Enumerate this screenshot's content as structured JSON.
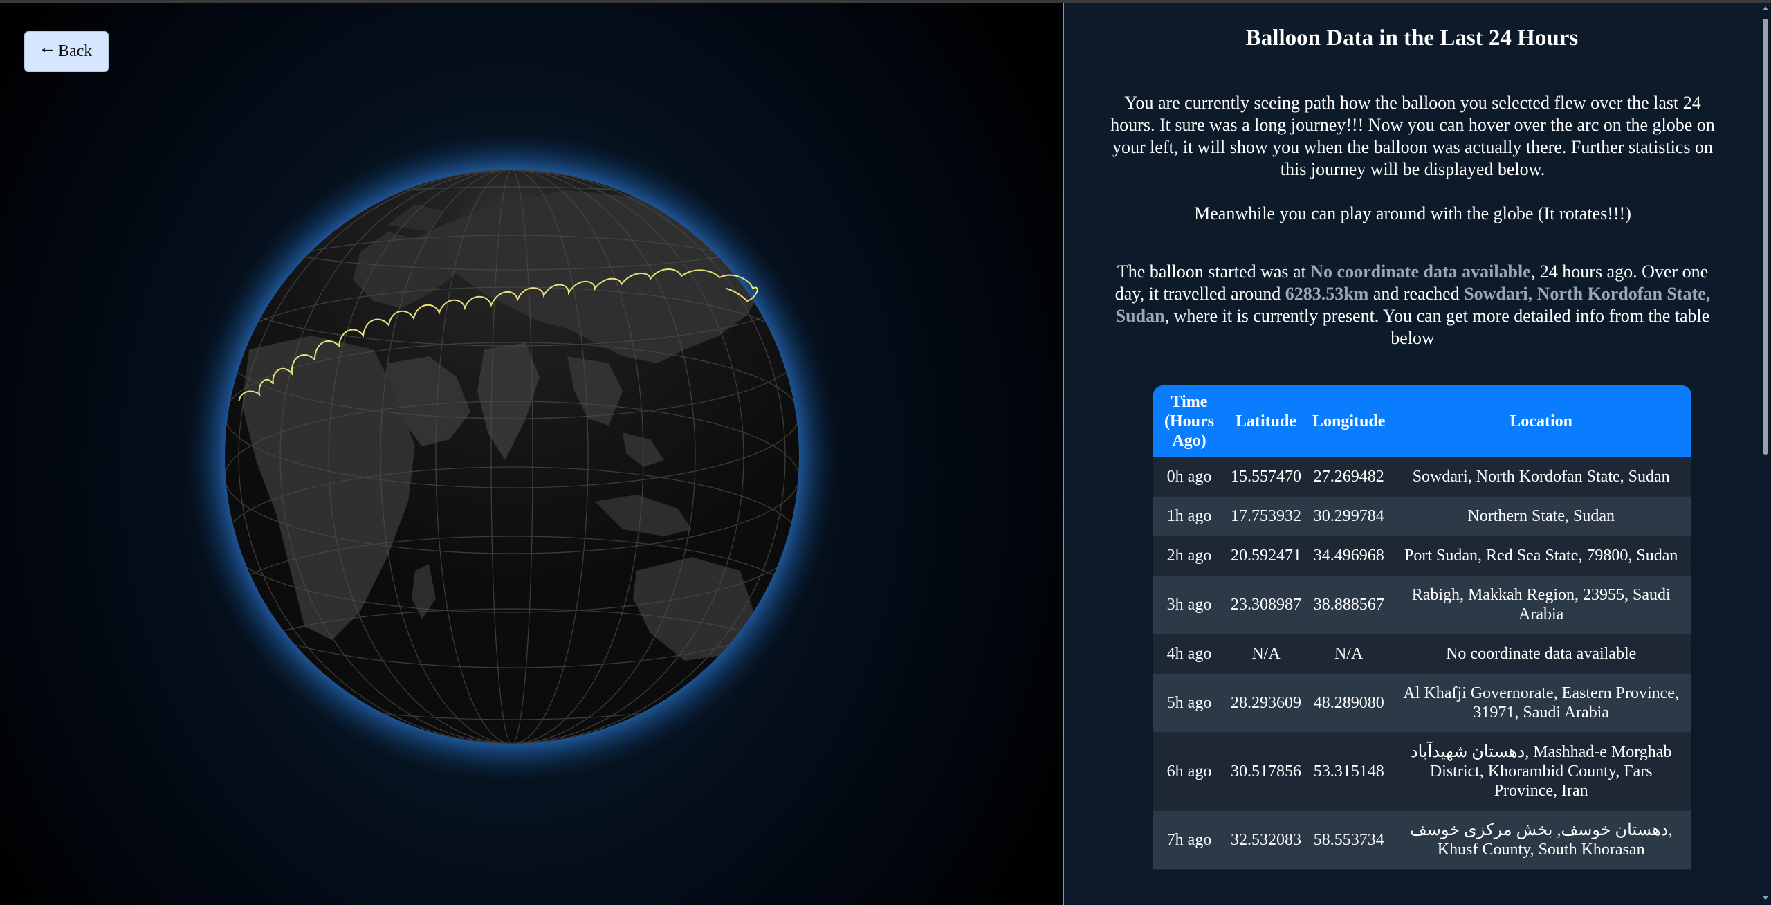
{
  "back_button": {
    "arrow": "🠐",
    "label": "Back"
  },
  "info": {
    "title": "Balloon Data in the Last 24 Hours",
    "intro": "You are currently seeing path how the balloon you selected flew over the last 24 hours. It sure was a long journey!!! Now you can hover over the arc on the globe on your left, it will show you when the balloon was actually there. Further statistics on this journey will be displayed below.",
    "play_note": "Meanwhile you can play around with the globe (It rotates!!!)",
    "summary_part1": "The balloon started was at ",
    "start_location": "No coordinate data available",
    "summary_part2": ", 24 hours ago. Over one day, it travelled around ",
    "distance": "6283.53km",
    "summary_part3": " and reached ",
    "end_location": "Sowdari, North Kordofan State, Sudan",
    "summary_part4": ", where it is currently present. You can get more detailed info from the table below"
  },
  "table": {
    "headers": [
      "Time (Hours Ago)",
      "Latitude",
      "Longitude",
      "Location"
    ],
    "rows": [
      [
        "0h ago",
        "15.557470",
        "27.269482",
        "Sowdari, North Kordofan State, Sudan"
      ],
      [
        "1h ago",
        "17.753932",
        "30.299784",
        "Northern State, Sudan"
      ],
      [
        "2h ago",
        "20.592471",
        "34.496968",
        "Port Sudan, Red Sea State, 79800, Sudan"
      ],
      [
        "3h ago",
        "23.308987",
        "38.888567",
        "Rabigh, Makkah Region, 23955, Saudi Arabia"
      ],
      [
        "4h ago",
        "N/A",
        "N/A",
        "No coordinate data available"
      ],
      [
        "5h ago",
        "28.293609",
        "48.289080",
        "Al Khafji Governorate, Eastern Province, 31971, Saudi Arabia"
      ],
      [
        "6h ago",
        "30.517856",
        "53.315148",
        "دهستان شهیدآباد, Mashhad-e Morghab District, Khorambid County, Fars Province, Iran"
      ],
      [
        "7h ago",
        "32.532083",
        "58.553734",
        "دهستان خوسف, بخش مرکزی خوسف, Khusf County, South Khorasan"
      ]
    ]
  },
  "colors": {
    "accent": "#0a7dff",
    "highlight": "#9ba6b3",
    "path": "#e8e27a"
  }
}
